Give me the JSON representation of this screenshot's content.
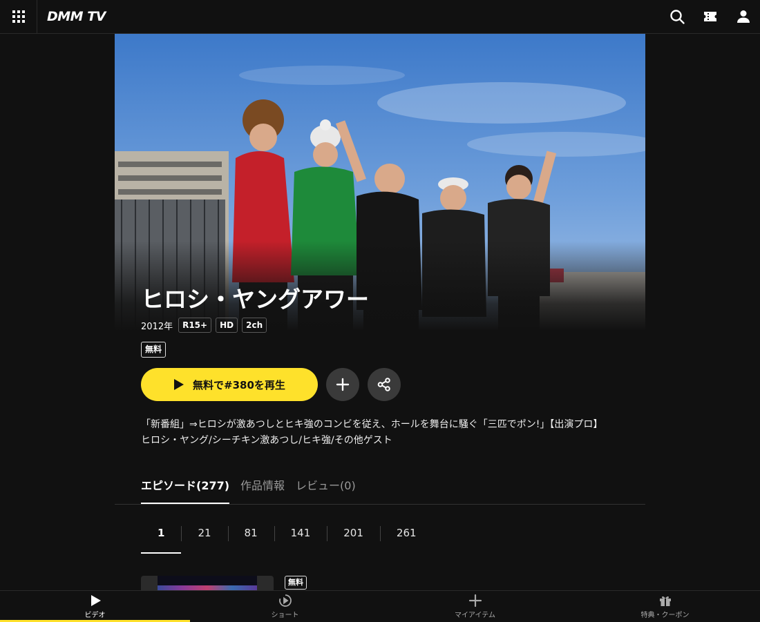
{
  "header": {
    "logo": "DMM TV",
    "icons": [
      "grid-menu-icon",
      "search-icon",
      "ticket-icon",
      "user-icon"
    ]
  },
  "hero": {
    "title": "ヒロシ・ヤングアワー",
    "year": "2012年",
    "badges": [
      "R15+",
      "HD",
      "2ch"
    ],
    "free_label": "無料"
  },
  "actions": {
    "play_label": "無料で#380を再生",
    "add_icon": "plus-icon",
    "share_icon": "share-icon"
  },
  "description": {
    "line1": "「新番組」⇒ヒロシが激あつしとヒキ強のコンビを従え、ホールを舞台に騒ぐ「三匹でポン!」【出演プロ】",
    "line2": "ヒロシ・ヤング/シーチキン激あつし/ヒキ強/その他ゲスト"
  },
  "tabs": [
    {
      "label": "エピソード(277)",
      "active": true
    },
    {
      "label": "作品情報",
      "active": false
    },
    {
      "label": "レビュー(0)",
      "active": false
    }
  ],
  "episode_ranges": [
    "1",
    "21",
    "81",
    "141",
    "201",
    "261"
  ],
  "episode_list": {
    "first_badge": "無料"
  },
  "bottom_nav": [
    {
      "label": "ビデオ",
      "icon": "play-icon",
      "active": true
    },
    {
      "label": "ショート",
      "icon": "short-play-icon",
      "active": false
    },
    {
      "label": "マイアイテム",
      "icon": "plus-icon",
      "active": false
    },
    {
      "label": "特典・クーポン",
      "icon": "gift-icon",
      "active": false
    }
  ],
  "colors": {
    "background": "#111111",
    "accent_yellow": "#fee12b",
    "button_gray": "#3a3a3a"
  }
}
